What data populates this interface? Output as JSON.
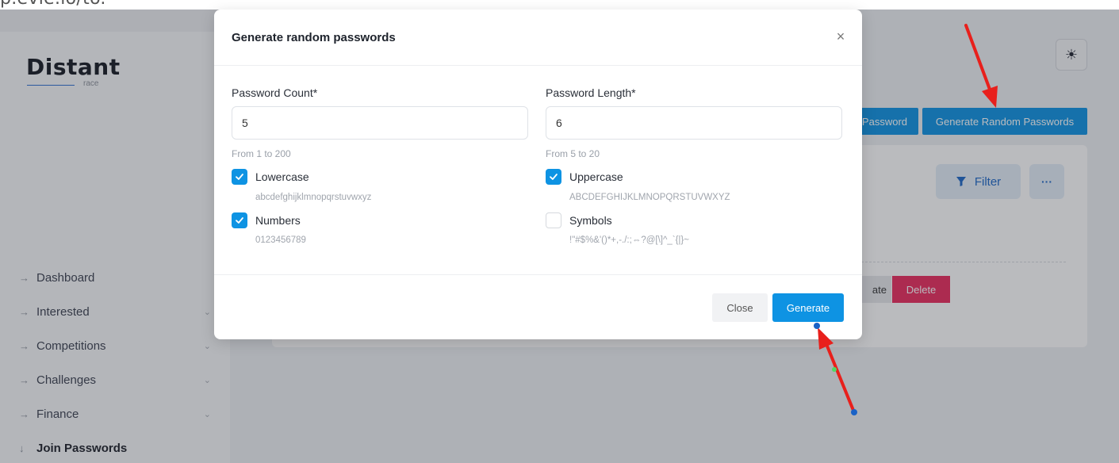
{
  "top_text": "p.evie.io/to.",
  "sidebar": {
    "logo": "Distant",
    "logo_sub": "race",
    "items": [
      {
        "label": "Dashboard",
        "has_children": false
      },
      {
        "label": "Interested",
        "has_children": true
      },
      {
        "label": "Competitions",
        "has_children": true
      },
      {
        "label": "Challenges",
        "has_children": true
      },
      {
        "label": "Finance",
        "has_children": true
      },
      {
        "label": "Join Passwords",
        "has_children": false,
        "active": true
      }
    ]
  },
  "header": {
    "password_button_partial": "Password",
    "generate_random_button": "Generate Random Passwords",
    "theme_icon": "sun-icon"
  },
  "toolbar": {
    "filter_label": "Filter",
    "more_label": "···"
  },
  "row_actions": {
    "activate_partial": "ate",
    "delete_label": "Delete"
  },
  "modal": {
    "title": "Generate random passwords",
    "close_icon": "×",
    "count": {
      "label": "Password Count*",
      "value": "5",
      "hint": "From 1 to 200"
    },
    "length": {
      "label": "Password Length*",
      "value": "6",
      "hint": "From 5 to 20"
    },
    "options": {
      "lowercase": {
        "label": "Lowercase",
        "checked": true,
        "chars": "abcdefghijklmnopqrstuvwxyz"
      },
      "uppercase": {
        "label": "Uppercase",
        "checked": true,
        "chars": "ABCDEFGHIJKLMNOPQRSTUVWXYZ"
      },
      "numbers": {
        "label": "Numbers",
        "checked": true,
        "chars": "0123456789"
      },
      "symbols": {
        "label": "Symbols",
        "checked": false,
        "chars": "!\"#$%&'()*+,-./:;⇔?@[\\]^_`{|}~"
      }
    },
    "close_button": "Close",
    "generate_button": "Generate"
  },
  "colors": {
    "primary": "#0e93e3",
    "danger": "#ea2b5e",
    "annotation_arrow": "#e8201c",
    "annotation_dot": "#1a62c6"
  }
}
